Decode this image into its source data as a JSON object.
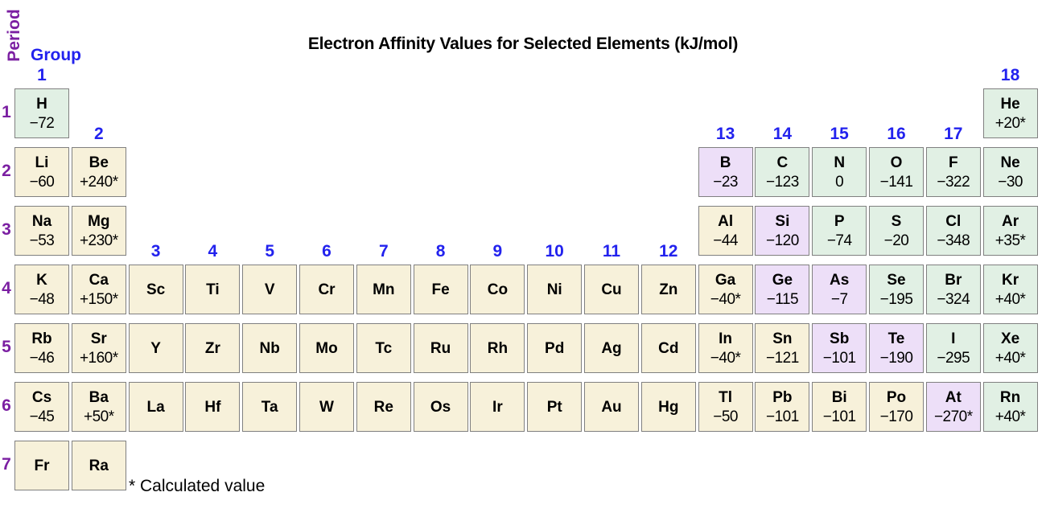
{
  "title": "Electron Affinity Values for Selected Elements (kJ/mol)",
  "axis": {
    "period_label": "Period",
    "group_label": "Group"
  },
  "footnote": "* Calculated value",
  "colors": {
    "nonmetal": "#e1f0e4",
    "metalloid": "#eddff8",
    "metal": "#f7f1da",
    "period_text": "#7b1fa2",
    "group_text": "#2222ee",
    "cell_border": "#808080",
    "background": "#ffffff"
  },
  "group_numbers": [
    "1",
    "2",
    "3",
    "4",
    "5",
    "6",
    "7",
    "8",
    "9",
    "10",
    "11",
    "12",
    "13",
    "14",
    "15",
    "16",
    "17",
    "18"
  ],
  "period_numbers": [
    "1",
    "2",
    "3",
    "4",
    "5",
    "6",
    "7"
  ],
  "chart_data": {
    "type": "table",
    "title": "Electron Affinity Values for Selected Elements (kJ/mol)",
    "xlabel": "Group",
    "ylabel": "Period",
    "units": "kJ/mol",
    "note": "* Calculated value",
    "categories_legend": [
      {
        "key": "nonmetal",
        "color": "#e1f0e4"
      },
      {
        "key": "metalloid",
        "color": "#eddff8"
      },
      {
        "key": "metal",
        "color": "#f7f1da"
      }
    ],
    "cells": [
      {
        "symbol": "H",
        "value": "−72",
        "period": 1,
        "group": 1,
        "category": "nonmetal"
      },
      {
        "symbol": "He",
        "value": "+20*",
        "period": 1,
        "group": 18,
        "category": "nonmetal"
      },
      {
        "symbol": "Li",
        "value": "−60",
        "period": 2,
        "group": 1,
        "category": "metal"
      },
      {
        "symbol": "Be",
        "value": "+240*",
        "period": 2,
        "group": 2,
        "category": "metal"
      },
      {
        "symbol": "B",
        "value": "−23",
        "period": 2,
        "group": 13,
        "category": "metalloid"
      },
      {
        "symbol": "C",
        "value": "−123",
        "period": 2,
        "group": 14,
        "category": "nonmetal"
      },
      {
        "symbol": "N",
        "value": "0",
        "period": 2,
        "group": 15,
        "category": "nonmetal"
      },
      {
        "symbol": "O",
        "value": "−141",
        "period": 2,
        "group": 16,
        "category": "nonmetal"
      },
      {
        "symbol": "F",
        "value": "−322",
        "period": 2,
        "group": 17,
        "category": "nonmetal"
      },
      {
        "symbol": "Ne",
        "value": "−30",
        "period": 2,
        "group": 18,
        "category": "nonmetal"
      },
      {
        "symbol": "Na",
        "value": "−53",
        "period": 3,
        "group": 1,
        "category": "metal"
      },
      {
        "symbol": "Mg",
        "value": "+230*",
        "period": 3,
        "group": 2,
        "category": "metal"
      },
      {
        "symbol": "Al",
        "value": "−44",
        "period": 3,
        "group": 13,
        "category": "metal"
      },
      {
        "symbol": "Si",
        "value": "−120",
        "period": 3,
        "group": 14,
        "category": "metalloid"
      },
      {
        "symbol": "P",
        "value": "−74",
        "period": 3,
        "group": 15,
        "category": "nonmetal"
      },
      {
        "symbol": "S",
        "value": "−20",
        "period": 3,
        "group": 16,
        "category": "nonmetal"
      },
      {
        "symbol": "Cl",
        "value": "−348",
        "period": 3,
        "group": 17,
        "category": "nonmetal"
      },
      {
        "symbol": "Ar",
        "value": "+35*",
        "period": 3,
        "group": 18,
        "category": "nonmetal"
      },
      {
        "symbol": "K",
        "value": "−48",
        "period": 4,
        "group": 1,
        "category": "metal"
      },
      {
        "symbol": "Ca",
        "value": "+150*",
        "period": 4,
        "group": 2,
        "category": "metal"
      },
      {
        "symbol": "Sc",
        "value": "",
        "period": 4,
        "group": 3,
        "category": "metal"
      },
      {
        "symbol": "Ti",
        "value": "",
        "period": 4,
        "group": 4,
        "category": "metal"
      },
      {
        "symbol": "V",
        "value": "",
        "period": 4,
        "group": 5,
        "category": "metal"
      },
      {
        "symbol": "Cr",
        "value": "",
        "period": 4,
        "group": 6,
        "category": "metal"
      },
      {
        "symbol": "Mn",
        "value": "",
        "period": 4,
        "group": 7,
        "category": "metal"
      },
      {
        "symbol": "Fe",
        "value": "",
        "period": 4,
        "group": 8,
        "category": "metal"
      },
      {
        "symbol": "Co",
        "value": "",
        "period": 4,
        "group": 9,
        "category": "metal"
      },
      {
        "symbol": "Ni",
        "value": "",
        "period": 4,
        "group": 10,
        "category": "metal"
      },
      {
        "symbol": "Cu",
        "value": "",
        "period": 4,
        "group": 11,
        "category": "metal"
      },
      {
        "symbol": "Zn",
        "value": "",
        "period": 4,
        "group": 12,
        "category": "metal"
      },
      {
        "symbol": "Ga",
        "value": "−40*",
        "period": 4,
        "group": 13,
        "category": "metal"
      },
      {
        "symbol": "Ge",
        "value": "−115",
        "period": 4,
        "group": 14,
        "category": "metalloid"
      },
      {
        "symbol": "As",
        "value": "−7",
        "period": 4,
        "group": 15,
        "category": "metalloid"
      },
      {
        "symbol": "Se",
        "value": "−195",
        "period": 4,
        "group": 16,
        "category": "nonmetal"
      },
      {
        "symbol": "Br",
        "value": "−324",
        "period": 4,
        "group": 17,
        "category": "nonmetal"
      },
      {
        "symbol": "Kr",
        "value": "+40*",
        "period": 4,
        "group": 18,
        "category": "nonmetal"
      },
      {
        "symbol": "Rb",
        "value": "−46",
        "period": 5,
        "group": 1,
        "category": "metal"
      },
      {
        "symbol": "Sr",
        "value": "+160*",
        "period": 5,
        "group": 2,
        "category": "metal"
      },
      {
        "symbol": "Y",
        "value": "",
        "period": 5,
        "group": 3,
        "category": "metal"
      },
      {
        "symbol": "Zr",
        "value": "",
        "period": 5,
        "group": 4,
        "category": "metal"
      },
      {
        "symbol": "Nb",
        "value": "",
        "period": 5,
        "group": 5,
        "category": "metal"
      },
      {
        "symbol": "Mo",
        "value": "",
        "period": 5,
        "group": 6,
        "category": "metal"
      },
      {
        "symbol": "Tc",
        "value": "",
        "period": 5,
        "group": 7,
        "category": "metal"
      },
      {
        "symbol": "Ru",
        "value": "",
        "period": 5,
        "group": 8,
        "category": "metal"
      },
      {
        "symbol": "Rh",
        "value": "",
        "period": 5,
        "group": 9,
        "category": "metal"
      },
      {
        "symbol": "Pd",
        "value": "",
        "period": 5,
        "group": 10,
        "category": "metal"
      },
      {
        "symbol": "Ag",
        "value": "",
        "period": 5,
        "group": 11,
        "category": "metal"
      },
      {
        "symbol": "Cd",
        "value": "",
        "period": 5,
        "group": 12,
        "category": "metal"
      },
      {
        "symbol": "In",
        "value": "−40*",
        "period": 5,
        "group": 13,
        "category": "metal"
      },
      {
        "symbol": "Sn",
        "value": "−121",
        "period": 5,
        "group": 14,
        "category": "metal"
      },
      {
        "symbol": "Sb",
        "value": "−101",
        "period": 5,
        "group": 15,
        "category": "metalloid"
      },
      {
        "symbol": "Te",
        "value": "−190",
        "period": 5,
        "group": 16,
        "category": "metalloid"
      },
      {
        "symbol": "I",
        "value": "−295",
        "period": 5,
        "group": 17,
        "category": "nonmetal"
      },
      {
        "symbol": "Xe",
        "value": "+40*",
        "period": 5,
        "group": 18,
        "category": "nonmetal"
      },
      {
        "symbol": "Cs",
        "value": "−45",
        "period": 6,
        "group": 1,
        "category": "metal"
      },
      {
        "symbol": "Ba",
        "value": "+50*",
        "period": 6,
        "group": 2,
        "category": "metal"
      },
      {
        "symbol": "La",
        "value": "",
        "period": 6,
        "group": 3,
        "category": "metal"
      },
      {
        "symbol": "Hf",
        "value": "",
        "period": 6,
        "group": 4,
        "category": "metal"
      },
      {
        "symbol": "Ta",
        "value": "",
        "period": 6,
        "group": 5,
        "category": "metal"
      },
      {
        "symbol": "W",
        "value": "",
        "period": 6,
        "group": 6,
        "category": "metal"
      },
      {
        "symbol": "Re",
        "value": "",
        "period": 6,
        "group": 7,
        "category": "metal"
      },
      {
        "symbol": "Os",
        "value": "",
        "period": 6,
        "group": 8,
        "category": "metal"
      },
      {
        "symbol": "Ir",
        "value": "",
        "period": 6,
        "group": 9,
        "category": "metal"
      },
      {
        "symbol": "Pt",
        "value": "",
        "period": 6,
        "group": 10,
        "category": "metal"
      },
      {
        "symbol": "Au",
        "value": "",
        "period": 6,
        "group": 11,
        "category": "metal"
      },
      {
        "symbol": "Hg",
        "value": "",
        "period": 6,
        "group": 12,
        "category": "metal"
      },
      {
        "symbol": "Tl",
        "value": "−50",
        "period": 6,
        "group": 13,
        "category": "metal"
      },
      {
        "symbol": "Pb",
        "value": "−101",
        "period": 6,
        "group": 14,
        "category": "metal"
      },
      {
        "symbol": "Bi",
        "value": "−101",
        "period": 6,
        "group": 15,
        "category": "metal"
      },
      {
        "symbol": "Po",
        "value": "−170",
        "period": 6,
        "group": 16,
        "category": "metal"
      },
      {
        "symbol": "At",
        "value": "−270*",
        "period": 6,
        "group": 17,
        "category": "metalloid"
      },
      {
        "symbol": "Rn",
        "value": "+40*",
        "period": 6,
        "group": 18,
        "category": "nonmetal"
      },
      {
        "symbol": "Fr",
        "value": "",
        "period": 7,
        "group": 1,
        "category": "metal"
      },
      {
        "symbol": "Ra",
        "value": "",
        "period": 7,
        "group": 2,
        "category": "metal"
      }
    ],
    "group_header_rows": {
      "1": 1,
      "2": 2,
      "3": 4,
      "4": 4,
      "5": 4,
      "6": 4,
      "7": 4,
      "8": 4,
      "9": 4,
      "10": 4,
      "11": 4,
      "12": 4,
      "13": 2,
      "14": 2,
      "15": 2,
      "16": 2,
      "17": 2,
      "18": 1
    }
  }
}
